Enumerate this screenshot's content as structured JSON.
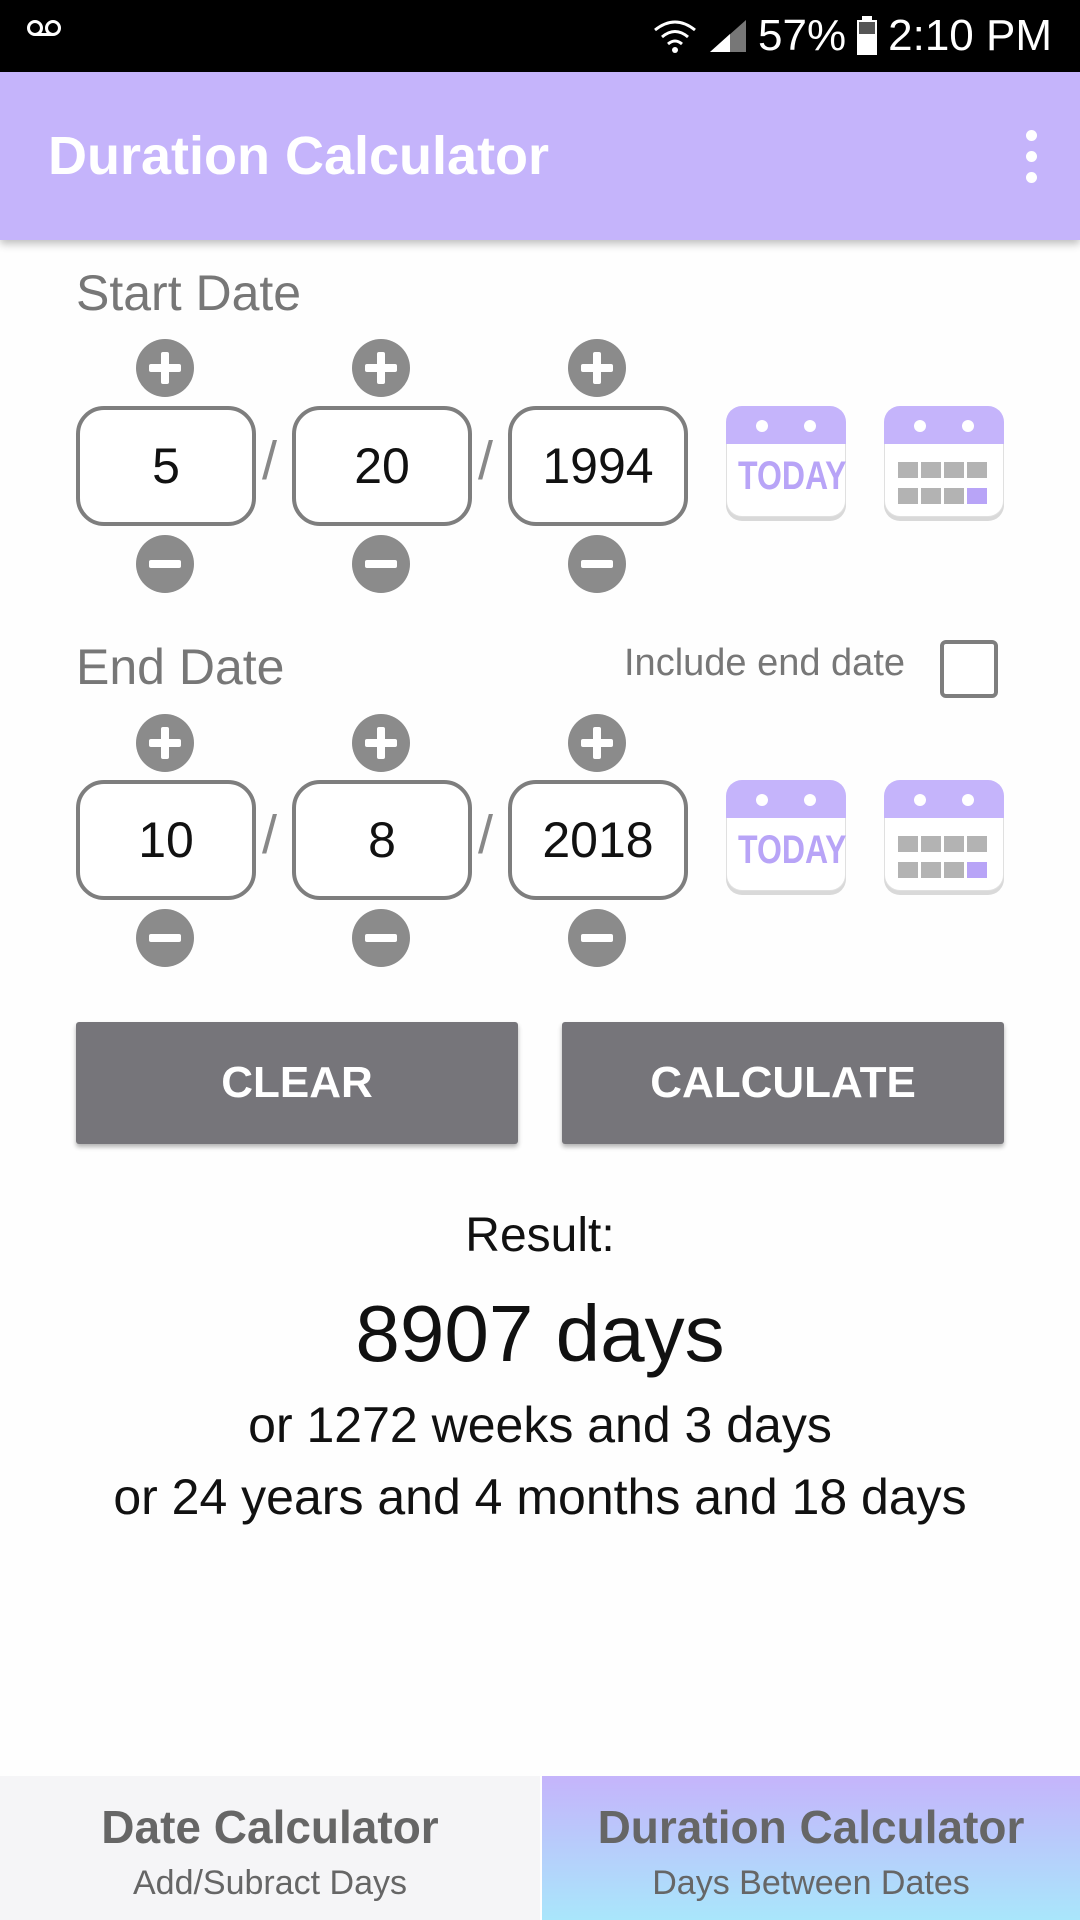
{
  "status_bar": {
    "battery": "57%",
    "time": "2:10 PM"
  },
  "app_bar": {
    "title": "Duration Calculator"
  },
  "start_date": {
    "label": "Start Date",
    "month": "5",
    "day": "20",
    "year": "1994",
    "separator": "/",
    "today_label": "TODAY"
  },
  "end_date": {
    "label": "End Date",
    "month": "10",
    "day": "8",
    "year": "2018",
    "separator": "/",
    "today_label": "TODAY",
    "include_end_label": "Include end date",
    "include_end_checked": false
  },
  "actions": {
    "clear": "CLEAR",
    "calculate": "CALCULATE"
  },
  "result": {
    "heading": "Result:",
    "days": "8907 days",
    "weeks": "or 1272 weeks and 3 days",
    "ymd": "or 24 years and 4 months and 18 days"
  },
  "bottom_nav": [
    {
      "title": "Date Calculator",
      "subtitle": "Add/Subract Days",
      "selected": false
    },
    {
      "title": "Duration Calculator",
      "subtitle": "Days Between Dates",
      "selected": true
    }
  ],
  "colors": {
    "accent": "#c5b4fb",
    "button": "#76757a",
    "stepper": "#8b8b8b",
    "selected_tab_gradient": [
      "#c5b4fb",
      "#a9e6fb"
    ]
  },
  "icons": {
    "status": [
      "voicemail-icon",
      "wifi-icon",
      "signal-icon",
      "battery-icon"
    ],
    "app_bar": "more-vert-icon",
    "steppers": [
      "plus-icon",
      "minus-icon"
    ],
    "calendar_buttons": [
      "today-calendar-icon",
      "calendar-grid-icon"
    ]
  }
}
